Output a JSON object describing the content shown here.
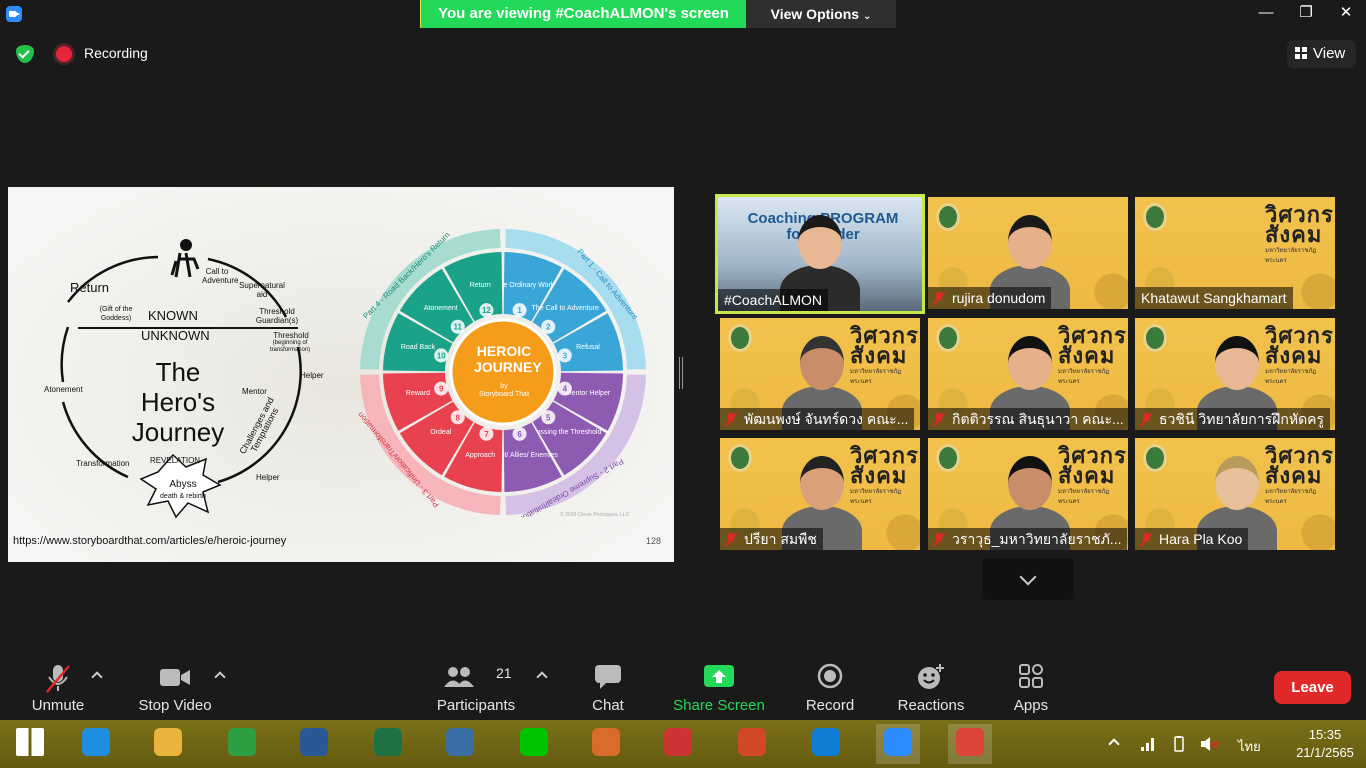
{
  "banner": {
    "viewing_text": "You are viewing #CoachALMON's screen",
    "view_options": "View Options"
  },
  "window_controls": {
    "minimize": "—",
    "maximize": "❐",
    "close": "✕"
  },
  "meeting": {
    "recording_label": "Recording",
    "view_label": "View"
  },
  "slide": {
    "url": "https://www.storyboardthat.com/articles/e/heroic-journey",
    "page_number": "128",
    "left_title": "The Hero's Journey",
    "labels": {
      "return": "Return",
      "gift": "(Gift of the Goddess)",
      "known": "KNOWN",
      "unknown": "UNKNOWN",
      "call": "Call to Adventure",
      "supernatural": "Supernatural aid",
      "threshold_guardians": "Threshold Guardian(s)",
      "threshold": "Threshold",
      "threshold_sub": "(beginning of transformation)",
      "helper": "Helper",
      "mentor": "Mentor",
      "atonement": "Atonement",
      "challenges": "Challenges and Temptations",
      "revelation": "REVELATION",
      "transformation": "Transformation",
      "abyss": "Abyss",
      "abyss_sub": "death & rebirth",
      "helper2": "Helper"
    },
    "wheel": {
      "center_title": "HEROIC JOURNEY",
      "center_by": "by",
      "center_brand": "Storyboard That",
      "parts": [
        "Part 1 - Call to Adventure",
        "Part 2 - Supreme Ordeal/Initiation",
        "Part 3 - Unification/Transformation",
        "Part 4 - Road Back/Hero's Return"
      ],
      "steps": [
        {
          "n": "1",
          "label": "The Ordinary World",
          "color": "#3aa6d8"
        },
        {
          "n": "2",
          "label": "The Call to Adventure",
          "color": "#3aa6d8"
        },
        {
          "n": "3",
          "label": "Refusal",
          "color": "#3aa6d8"
        },
        {
          "n": "4",
          "label": "Mentor Helper",
          "color": "#8e5bb3"
        },
        {
          "n": "5",
          "label": "Crossing the Threshold",
          "color": "#8e5bb3"
        },
        {
          "n": "6",
          "label": "Test/ Allies/ Enemies",
          "color": "#8e5bb3"
        },
        {
          "n": "7",
          "label": "Approach",
          "color": "#e8414f"
        },
        {
          "n": "8",
          "label": "Ordeal",
          "color": "#e8414f"
        },
        {
          "n": "9",
          "label": "Reward",
          "color": "#e8414f"
        },
        {
          "n": "10",
          "label": "Road Back",
          "color": "#1ba38a"
        },
        {
          "n": "11",
          "label": "Atonement",
          "color": "#1ba38a"
        },
        {
          "n": "12",
          "label": "Return",
          "color": "#1ba38a"
        }
      ],
      "copyright": "© 2018 Clever Prototypes, LLC"
    }
  },
  "participants_tiles": [
    {
      "name": "#CoachALMON",
      "muted": false,
      "active": true,
      "overlay": "Coaching PROGRAM for Leader"
    },
    {
      "name": "rujira donudom",
      "muted": true,
      "active": false
    },
    {
      "name": "Khatawut Sangkhamart",
      "muted": false,
      "active": false
    },
    {
      "name": "พัฒนพงษ์ จันทร์ดวง คณะ...",
      "muted": true,
      "active": false
    },
    {
      "name": "กิตติวรรณ สินธุนาวา คณะ...",
      "muted": true,
      "active": false
    },
    {
      "name": "ธวชินี วิทยาลัยการฝึกหัดครู",
      "muted": true,
      "active": false
    },
    {
      "name": "ปรียา สมพืช",
      "muted": true,
      "active": false
    },
    {
      "name": "วราวุธ_มหาวิทยาลัยราชภั...",
      "muted": true,
      "active": false
    },
    {
      "name": "Hara Pla Koo",
      "muted": true,
      "active": false
    }
  ],
  "tile_brand": {
    "line1": "วิศวกร",
    "line2": "สังคม",
    "sub": "มหาวิทยาลัยราชภัฏพระนคร"
  },
  "toolbar": {
    "unmute": "Unmute",
    "stop_video": "Stop Video",
    "participants": "Participants",
    "participants_count": "21",
    "chat": "Chat",
    "share_screen": "Share Screen",
    "record": "Record",
    "reactions": "Reactions",
    "apps": "Apps",
    "leave": "Leave"
  },
  "taskbar": {
    "apps": [
      "start-button",
      "internet-explorer-icon",
      "file-explorer-icon",
      "store-icon",
      "word-icon",
      "excel-icon",
      "calculator-math-icon",
      "line-icon",
      "paint-icon",
      "lisrel-icon",
      "powerpoint-icon",
      "edge-icon",
      "zoom-icon",
      "chrome-icon"
    ],
    "time": "15:35",
    "date": "21/1/2565",
    "language": "ไทย"
  }
}
